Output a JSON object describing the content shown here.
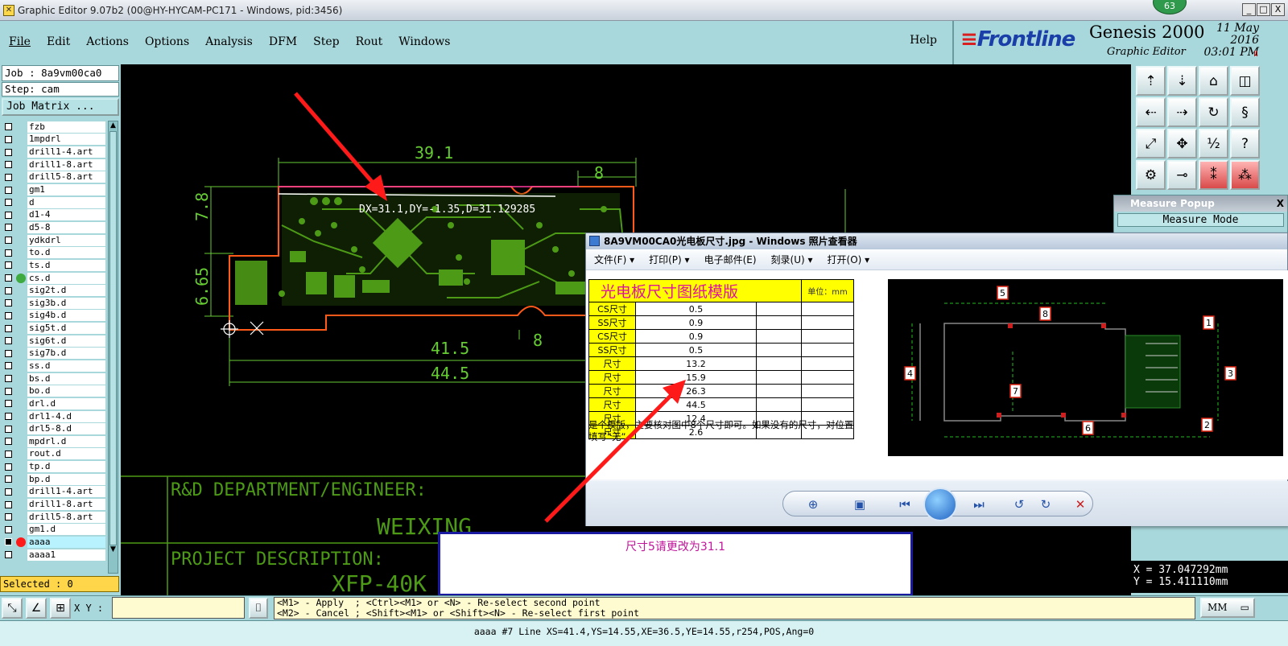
{
  "titlebar": {
    "title": "Graphic Editor 9.07b2 (00@HY-HYCAM-PC171 - Windows, pid:3456)",
    "badge": "63",
    "min": "_",
    "max": "□",
    "close": "X"
  },
  "menu": {
    "items": [
      "File",
      "Edit",
      "Actions",
      "Options",
      "Analysis",
      "DFM",
      "Step",
      "Rout",
      "Windows"
    ],
    "help": "Help"
  },
  "brand": {
    "logo": "Frontline",
    "product": "Genesis 2000",
    "subtitle": "Graphic Editor",
    "date": "11 May 2016",
    "time": "03:01 PM",
    "marker": "II"
  },
  "job": {
    "job_line": "Job : 8a9vm00ca0",
    "step_line": "Step: cam",
    "matrix_button": "Job Matrix ..."
  },
  "layers": [
    {
      "name": "fzb"
    },
    {
      "name": "1mpdrl"
    },
    {
      "name": "drill1-4.art"
    },
    {
      "name": "drill1-8.art"
    },
    {
      "name": "drill5-8.art"
    },
    {
      "name": "gm1"
    },
    {
      "name": "d"
    },
    {
      "name": "d1-4"
    },
    {
      "name": "d5-8"
    },
    {
      "name": "ydkdrl"
    },
    {
      "name": "to.d"
    },
    {
      "name": "ts.d"
    },
    {
      "name": "cs.d"
    },
    {
      "name": "sig2t.d"
    },
    {
      "name": "sig3b.d"
    },
    {
      "name": "sig4b.d"
    },
    {
      "name": "sig5t.d"
    },
    {
      "name": "sig6t.d"
    },
    {
      "name": "sig7b.d"
    },
    {
      "name": "ss.d"
    },
    {
      "name": "bs.d"
    },
    {
      "name": "bo.d"
    },
    {
      "name": "drl.d"
    },
    {
      "name": "drl1-4.d"
    },
    {
      "name": "drl5-8.d"
    },
    {
      "name": "mpdrl.d"
    },
    {
      "name": "rout.d"
    },
    {
      "name": "tp.d"
    },
    {
      "name": "bp.d"
    },
    {
      "name": "drill1-4.art"
    },
    {
      "name": "drill1-8.art"
    },
    {
      "name": "drill5-8.art"
    },
    {
      "name": "gm1.d"
    },
    {
      "name": "aaaa"
    },
    {
      "name": "aaaa1"
    }
  ],
  "selected": "Selected : 0",
  "canvas": {
    "dims": [
      "39.1",
      "8",
      "7.8",
      "6.65",
      "41.5",
      "44.5",
      "8"
    ],
    "measure_text": "DX=31.1,DY=-1.35,D=31.129285",
    "title_block": [
      "R&D DEPARTMENT/ENGINEER:",
      "WEIXING",
      "PROJECT DESCRIPTION:",
      "XFP-40K"
    ]
  },
  "measure_popup": {
    "title": "Measure Popup",
    "mode": "Measure Mode",
    "close": "X"
  },
  "coords": {
    "x": "X = 37.047292mm",
    "y": "Y = 15.411110mm"
  },
  "viewer": {
    "title": "8A9VM00CA0光电板尺寸.jpg - Windows 照片查看器",
    "menu": [
      "文件(F) ▾",
      "打印(P) ▾",
      "电子邮件(E)",
      "刻录(U) ▾",
      "打开(O) ▾"
    ],
    "table_title": "光电板尺寸图纸模版",
    "unit": "单位：mm",
    "rows": [
      {
        "label": "CS尺寸",
        "value": "0.5"
      },
      {
        "label": "SS尺寸",
        "value": "0.9"
      },
      {
        "label": "CS尺寸",
        "value": "0.9"
      },
      {
        "label": "SS尺寸",
        "value": "0.5"
      },
      {
        "label": "尺寸",
        "value": "13.2"
      },
      {
        "label": "尺寸",
        "value": "15.9"
      },
      {
        "label": "尺寸",
        "value": "26.3"
      },
      {
        "label": "尺寸",
        "value": "44.5"
      },
      {
        "label": "尺寸",
        "value": "12.4"
      },
      {
        "label": "尺寸",
        "value": "2.6"
      }
    ],
    "note": "是个模版，主要核对图中8个尺寸即可。如果没有的尺寸，对位置填写“无”",
    "drawing_labels": [
      "5",
      "8",
      "1",
      "4",
      "3",
      "7",
      "2",
      "6"
    ]
  },
  "annotation": "尺寸5请更改为31.1",
  "cmd": {
    "xy_label": "X Y :",
    "xy_value": "",
    "hint_line1": "<M1> - Apply  ; <Ctrl><M1> or <N> - Re-select second point",
    "hint_line2": "<M2> - Cancel ; <Shift><M1> or <Shift><N> - Re-select first point",
    "units": "MM"
  },
  "status": "aaaa #7 Line XS=41.4,YS=14.55,XE=36.5,YE=14.55,r254,POS,Ang=0",
  "colors": {
    "panel": "#a9d8dc",
    "pcb_green": "#4c9a16",
    "outline": "#ff5a1a",
    "arrow": "#ff1a1a",
    "dim": "#66cc33"
  }
}
